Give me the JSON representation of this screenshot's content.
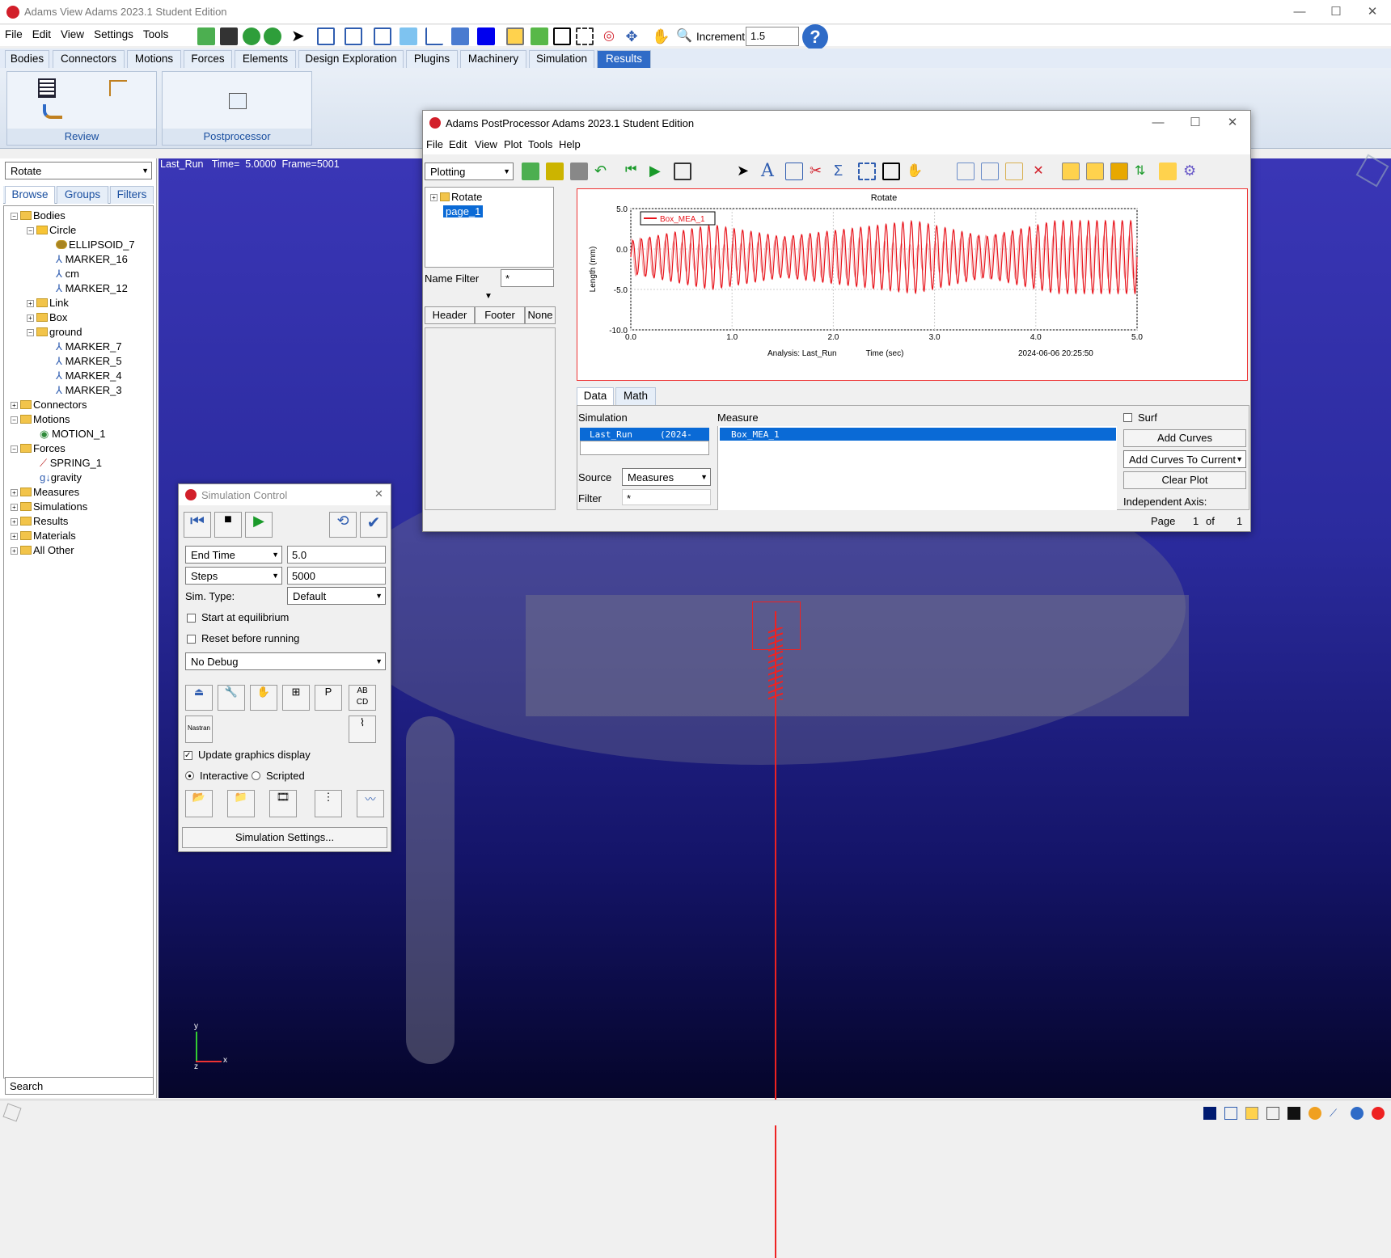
{
  "app": {
    "title": "Adams  View Adams 2023.1 Student Edition"
  },
  "menu": [
    "File",
    "Edit",
    "View",
    "Settings",
    "Tools"
  ],
  "toolbar": {
    "increment_label": "Increment",
    "increment_value": "1.5"
  },
  "tabs": [
    "Bodies",
    "Connectors",
    "Motions",
    "Forces",
    "Elements",
    "Design Exploration",
    "Plugins",
    "Machinery",
    "Simulation",
    "Results"
  ],
  "ribbon": {
    "review_label": "Review",
    "postprocessor_label": "Postprocessor"
  },
  "left": {
    "model_select": "Rotate",
    "tabs": [
      "Browse",
      "Groups",
      "Filters"
    ],
    "search_placeholder": "Search",
    "tree": [
      "Bodies",
      "Circle",
      "ELLIPSOID_7",
      "MARKER_16",
      "cm",
      "MARKER_12",
      "Link",
      "Box",
      "ground",
      "MARKER_7",
      "MARKER_5",
      "MARKER_4",
      "MARKER_3",
      "Connectors",
      "Motions",
      "MOTION_1",
      "Forces",
      "SPRING_1",
      "gravity",
      "Measures",
      "Simulations",
      "Results",
      "Materials",
      "All Other"
    ]
  },
  "viewport": {
    "status": "Last_Run   Time=  5.0000  Frame=5001",
    "axis_x": "x",
    "axis_y": "y",
    "axis_z": "z"
  },
  "sim": {
    "title": "Simulation Control",
    "end_time_label": "End Time",
    "end_time": "5.0",
    "steps_label": "Steps",
    "steps": "5000",
    "simtype_label": "Sim. Type:",
    "simtype": "Default",
    "start_eq": "Start at equilibrium",
    "reset": "Reset before running",
    "debug": "No Debug",
    "nastran": "Nastran",
    "update_graphics": "Update graphics display",
    "interactive": "Interactive",
    "scripted": "Scripted",
    "settings_btn": "Simulation Settings..."
  },
  "pp": {
    "title": "Adams  PostProcessor Adams 2023.1 Student Edition",
    "menu": [
      "File",
      "Edit",
      "View",
      "Plot",
      "Tools",
      "Help"
    ],
    "mode": "Plotting",
    "tree": [
      "Rotate",
      "page_1"
    ],
    "name_filter_label": "Name Filter",
    "name_filter": "*",
    "hf": [
      "Header",
      "Footer",
      "None"
    ],
    "data_tabs": [
      "Data",
      "Math"
    ],
    "simulation_label": "Simulation",
    "sim_item": "Last_Run",
    "sim_date": "(2024-",
    "measure_label": "Measure",
    "measure_item": "Box_MEA_1",
    "source_label": "Source",
    "source": "Measures",
    "filter_label": "Filter",
    "filter": "*",
    "surf": "Surf",
    "add_curves": "Add Curves",
    "add_curves_current": "Add Curves To Current",
    "clear_plot": "Clear Plot",
    "indep_axis": "Independent Axis:",
    "page_label": "Page",
    "page_num": "1",
    "of_label": "of",
    "page_total": "1"
  },
  "chart_data": {
    "type": "line",
    "title": "Rotate",
    "xlabel": "Time (sec)",
    "ylabel": "Length (mm)",
    "xlim": [
      0,
      5
    ],
    "ylim": [
      -10,
      5
    ],
    "xticks": [
      "0.0",
      "1.0",
      "2.0",
      "3.0",
      "4.0",
      "5.0"
    ],
    "yticks": [
      "5.0",
      "0.0",
      "-5.0",
      "-10.0"
    ],
    "series": [
      {
        "name": "Box_MEA_1",
        "color": "#e8141c",
        "carrier_hz": 12,
        "envelope_amp_mm": [
          2.0,
          4.0,
          2.5,
          4.5,
          2.5,
          4.5
        ],
        "envelope_t": [
          0,
          0.8,
          1.5,
          2.8,
          3.5,
          4.2
        ],
        "offset_mm": -1.0
      }
    ],
    "footer": {
      "analysis": "Analysis:  Last_Run",
      "date": "2024-06-06 20:25:50"
    },
    "legend": "top-left"
  }
}
